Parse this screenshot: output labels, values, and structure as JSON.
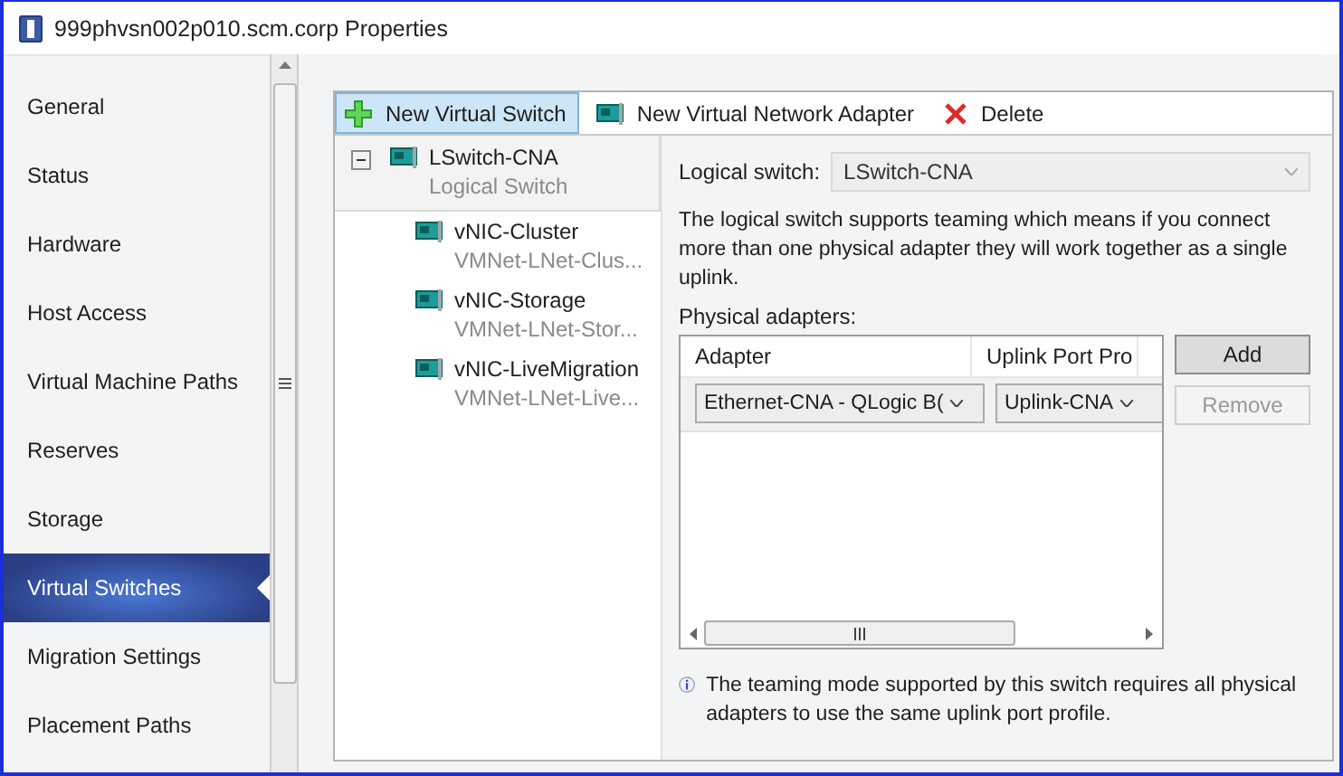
{
  "window": {
    "title": "999phvsn002p010.scm.corp Properties"
  },
  "sidebar": {
    "items": [
      {
        "label": "General",
        "selected": false
      },
      {
        "label": "Status",
        "selected": false
      },
      {
        "label": "Hardware",
        "selected": false
      },
      {
        "label": "Host Access",
        "selected": false
      },
      {
        "label": "Virtual Machine Paths",
        "selected": false
      },
      {
        "label": "Reserves",
        "selected": false
      },
      {
        "label": "Storage",
        "selected": false
      },
      {
        "label": "Virtual Switches",
        "selected": true
      },
      {
        "label": "Migration Settings",
        "selected": false
      },
      {
        "label": "Placement Paths",
        "selected": false
      }
    ]
  },
  "toolbar": [
    {
      "kind": "add",
      "label": "New Virtual Switch",
      "selected": true
    },
    {
      "kind": "adapter",
      "label": "New Virtual Network Adapter",
      "selected": false
    },
    {
      "kind": "delete",
      "label": "Delete",
      "selected": false
    }
  ],
  "tree": {
    "root": {
      "name": "LSwitch-CNA",
      "subtitle": "Logical Switch",
      "expanded": true,
      "selected": true,
      "children": [
        {
          "name": "vNIC-Cluster",
          "subtitle": "VMNet-LNet-Clus..."
        },
        {
          "name": "vNIC-Storage",
          "subtitle": "VMNet-LNet-Stor..."
        },
        {
          "name": "vNIC-LiveMigration",
          "subtitle": "VMNet-LNet-Live..."
        }
      ]
    }
  },
  "details": {
    "logical_switch_label": "Logical switch:",
    "logical_switch_value": "LSwitch-CNA",
    "description": "The logical switch supports teaming which means if you connect more than one physical adapter they will work together as a single uplink.",
    "adapters_label": "Physical adapters:",
    "table": {
      "columns": [
        "Adapter",
        "Uplink Port Pro"
      ],
      "rows": [
        {
          "adapter": "Ethernet-CNA - QLogic B(",
          "uplink": "Uplink-CNA"
        }
      ]
    },
    "buttons": [
      {
        "label": "Add",
        "disabled": false
      },
      {
        "label": "Remove",
        "disabled": true
      }
    ],
    "note": "The teaming mode supported by this switch requires all physical adapters to use the same uplink port profile."
  }
}
